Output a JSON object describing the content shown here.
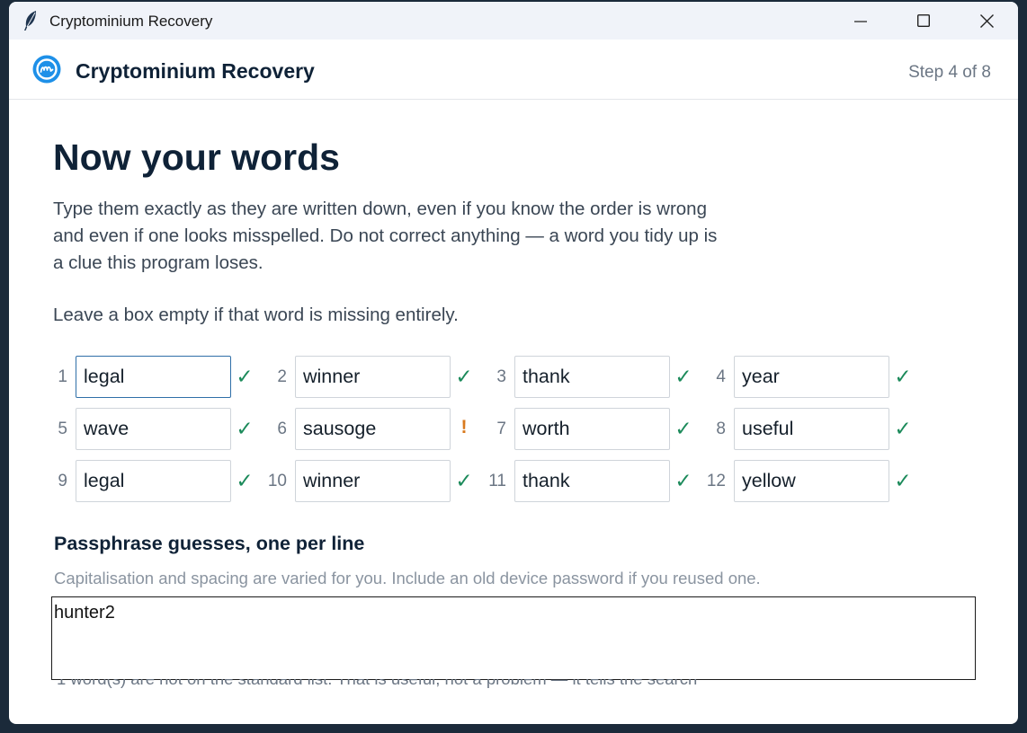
{
  "window": {
    "title": "Cryptominium Recovery",
    "icon": "feather-icon"
  },
  "header": {
    "brand": "Cryptominium Recovery",
    "step": "Step 4 of 8"
  },
  "main": {
    "heading": "Now your words",
    "instructions": "Type them exactly as they are written down, even if you know the order is wrong and even if one looks misspelled. Do not correct anything — a word you tidy up is a clue this program loses.",
    "empty_note": "Leave a box empty if that word is missing entirely.",
    "words": [
      {
        "n": "1",
        "value": "legal",
        "status": "✓"
      },
      {
        "n": "2",
        "value": "winner",
        "status": "✓"
      },
      {
        "n": "3",
        "value": "thank",
        "status": "✓"
      },
      {
        "n": "4",
        "value": "year",
        "status": "✓"
      },
      {
        "n": "5",
        "value": "wave",
        "status": "✓"
      },
      {
        "n": "6",
        "value": "sausoge",
        "status": "!"
      },
      {
        "n": "7",
        "value": "worth",
        "status": "✓"
      },
      {
        "n": "8",
        "value": "useful",
        "status": "✓"
      },
      {
        "n": "9",
        "value": "legal",
        "status": "✓"
      },
      {
        "n": "10",
        "value": "winner",
        "status": "✓"
      },
      {
        "n": "11",
        "value": "thank",
        "status": "✓"
      },
      {
        "n": "12",
        "value": "yellow",
        "status": "✓"
      }
    ],
    "passphrase": {
      "title": "Passphrase guesses, one per line",
      "help": "Capitalisation and spacing are varied for you. Include an old device password if you reused one.",
      "value": "hunter2"
    },
    "footer_note": "1 word(s) are not on the standard list. That is useful, not a problem — it tells the search"
  },
  "colors": {
    "ok": "#1b8a5a",
    "warn": "#d97a1e",
    "heading": "#0f2237",
    "focus_border": "#2f6fa8"
  }
}
